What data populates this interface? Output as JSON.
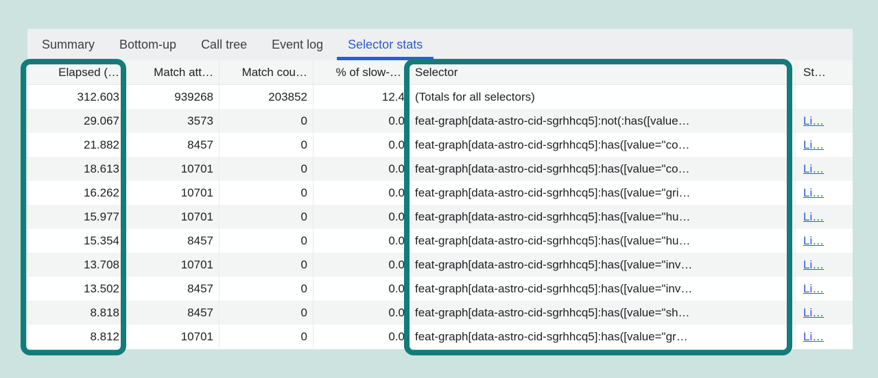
{
  "theme": {
    "page_bg": "#cde3df",
    "panel_bg": "#ffffff",
    "tabbar_bg": "#eeeff0",
    "header_bg": "#f4f5f5",
    "stripe_bg": "#f3f4f4",
    "accent_blue": "#2b5cd9",
    "link_blue": "#2b5cd9",
    "highlight_teal": "#127c7a"
  },
  "tabs": [
    {
      "label": "Summary",
      "active": false
    },
    {
      "label": "Bottom-up",
      "active": false
    },
    {
      "label": "Call tree",
      "active": false
    },
    {
      "label": "Event log",
      "active": false
    },
    {
      "label": "Selector stats",
      "active": true
    }
  ],
  "table": {
    "columns": [
      {
        "id": "elapsed",
        "label": "Elapsed (…",
        "align": "right"
      },
      {
        "id": "match_attempts",
        "label": "Match att…",
        "align": "right"
      },
      {
        "id": "match_count",
        "label": "Match cou…",
        "align": "right"
      },
      {
        "id": "slow_pct",
        "label": "% of slow-…",
        "align": "right"
      },
      {
        "id": "selector",
        "label": "Selector",
        "align": "left"
      },
      {
        "id": "style_sheet",
        "label": "St…",
        "align": "left"
      }
    ],
    "rows": [
      {
        "elapsed": "312.603",
        "match_attempts": "939268",
        "match_count": "203852",
        "slow_pct": "12.4",
        "selector": "(Totals for all selectors)",
        "style_sheet": ""
      },
      {
        "elapsed": "29.067",
        "match_attempts": "3573",
        "match_count": "0",
        "slow_pct": "0.0",
        "selector": "feat-graph[data-astro-cid-sgrhhcq5]:not(:has([value…",
        "style_sheet": "Li…"
      },
      {
        "elapsed": "21.882",
        "match_attempts": "8457",
        "match_count": "0",
        "slow_pct": "0.0",
        "selector": "feat-graph[data-astro-cid-sgrhhcq5]:has([value=\"co…",
        "style_sheet": "Li…"
      },
      {
        "elapsed": "18.613",
        "match_attempts": "10701",
        "match_count": "0",
        "slow_pct": "0.0",
        "selector": "feat-graph[data-astro-cid-sgrhhcq5]:has([value=\"co…",
        "style_sheet": "Li…"
      },
      {
        "elapsed": "16.262",
        "match_attempts": "10701",
        "match_count": "0",
        "slow_pct": "0.0",
        "selector": "feat-graph[data-astro-cid-sgrhhcq5]:has([value=\"gri…",
        "style_sheet": "Li…"
      },
      {
        "elapsed": "15.977",
        "match_attempts": "10701",
        "match_count": "0",
        "slow_pct": "0.0",
        "selector": "feat-graph[data-astro-cid-sgrhhcq5]:has([value=\"hu…",
        "style_sheet": "Li…"
      },
      {
        "elapsed": "15.354",
        "match_attempts": "8457",
        "match_count": "0",
        "slow_pct": "0.0",
        "selector": "feat-graph[data-astro-cid-sgrhhcq5]:has([value=\"hu…",
        "style_sheet": "Li…"
      },
      {
        "elapsed": "13.708",
        "match_attempts": "10701",
        "match_count": "0",
        "slow_pct": "0.0",
        "selector": "feat-graph[data-astro-cid-sgrhhcq5]:has([value=\"inv…",
        "style_sheet": "Li…"
      },
      {
        "elapsed": "13.502",
        "match_attempts": "8457",
        "match_count": "0",
        "slow_pct": "0.0",
        "selector": "feat-graph[data-astro-cid-sgrhhcq5]:has([value=\"inv…",
        "style_sheet": "Li…"
      },
      {
        "elapsed": "8.818",
        "match_attempts": "8457",
        "match_count": "0",
        "slow_pct": "0.0",
        "selector": "feat-graph[data-astro-cid-sgrhhcq5]:has([value=\"sh…",
        "style_sheet": "Li…"
      },
      {
        "elapsed": "8.812",
        "match_attempts": "10701",
        "match_count": "0",
        "slow_pct": "0.0",
        "selector": "feat-graph[data-astro-cid-sgrhhcq5]:has([value=\"gr…",
        "style_sheet": "Li…"
      }
    ]
  },
  "annotations": {
    "highlight_boxes": [
      "elapsed-column",
      "selector-column"
    ]
  }
}
